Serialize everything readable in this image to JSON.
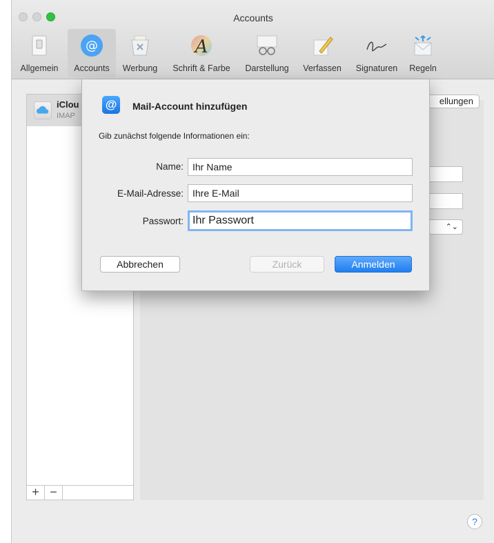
{
  "window": {
    "title": "Accounts"
  },
  "toolbar": {
    "items": [
      {
        "label": "Allgemein",
        "icon": "switch-icon"
      },
      {
        "label": "Accounts",
        "icon": "at-sign-icon"
      },
      {
        "label": "Werbung",
        "icon": "trash-junk-icon"
      },
      {
        "label": "Schrift & Farbe",
        "icon": "font-color-icon"
      },
      {
        "label": "Darstellung",
        "icon": "glasses-icon"
      },
      {
        "label": "Verfassen",
        "icon": "pencil-paper-icon"
      },
      {
        "label": "Signaturen",
        "icon": "signature-icon"
      },
      {
        "label": "Regeln",
        "icon": "rules-envelope-icon"
      }
    ],
    "selected": "Accounts"
  },
  "sidebar": {
    "account": {
      "name": "iClou",
      "type": "IMAP"
    },
    "add_label": "+",
    "remove_label": "−"
  },
  "background": {
    "settings_button": "ellungen"
  },
  "sheet": {
    "title": "Mail-Account hinzufügen",
    "info": "Gib zunächst folgende Informationen ein:",
    "fields": {
      "name_label": "Name:",
      "name_value": "Ihr Name",
      "email_label": "E-Mail-Adresse:",
      "email_value": "Ihre E-Mail",
      "password_label": "Passwort:",
      "password_value": "Ihr Passwort"
    },
    "buttons": {
      "cancel": "Abbrechen",
      "back": "Zurück",
      "login": "Anmelden"
    }
  },
  "help_label": "?",
  "colors": {
    "accent": "#1f7ef0",
    "zoom_button": "#2ec43f"
  }
}
